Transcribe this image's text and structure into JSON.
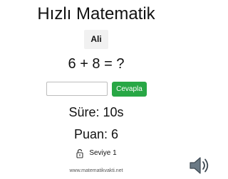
{
  "game": {
    "title": "Hızlı Matematik",
    "player_name": "Ali",
    "question": "6 + 8 = ?",
    "answer_value": "",
    "answer_placeholder": "",
    "submit_label": "Cevapla",
    "timer_text": "Süre: 10s",
    "score_text": "Puan: 6",
    "level_text": "Seviye 1",
    "level_icon": "padlock-icon"
  },
  "footer": {
    "site": "www.matematikvakti.net"
  },
  "controls": {
    "sound_icon": "speaker-icon"
  },
  "colors": {
    "accent": "#28a745",
    "player_box_bg": "#f1f1f1",
    "speaker_fill": "#6b7a86"
  }
}
